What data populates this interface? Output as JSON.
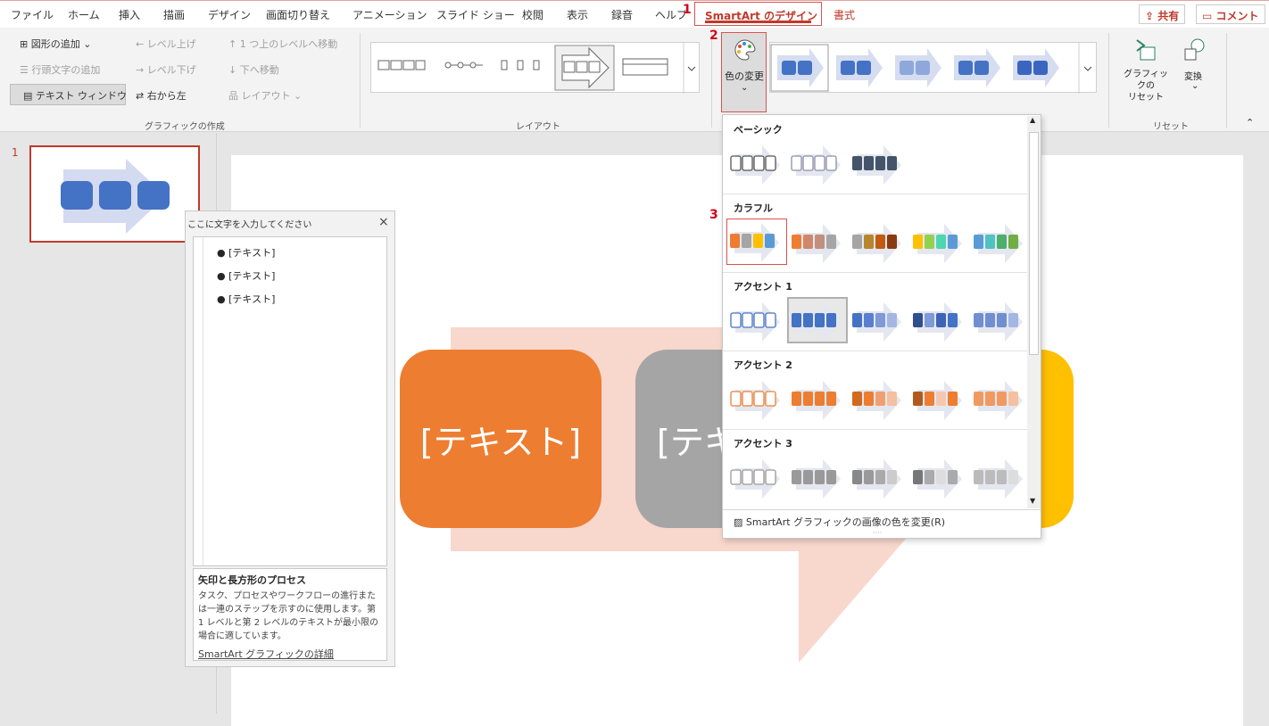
{
  "tabs": [
    "ファイル",
    "ホーム",
    "挿入",
    "描画",
    "デザイン",
    "画面切り替え",
    "アニメーション",
    "スライド ショー",
    "校閲",
    "表示",
    "録音",
    "ヘルプ"
  ],
  "active_tab": "SmartArt のデザイン",
  "format_tab": "書式",
  "share_label": "共有",
  "comment_label": "コメント",
  "steps": [
    "1",
    "2",
    "3"
  ],
  "create_group": {
    "title": "グラフィックの作成",
    "add_shape": "図形の追加",
    "add_bullet": "行頭文字の追加",
    "text_pane": "テキスト ウィンドウ",
    "promote": "レベル上げ",
    "demote": "レベル下げ",
    "rtl": "右から左",
    "move_up": "1 つ上のレベルへ移動",
    "move_down": "下へ移動",
    "layout": "レイアウト"
  },
  "layout_group": {
    "title": "レイアウト"
  },
  "change_colors": "色の変更",
  "reset_group": {
    "title": "リセット",
    "reset": "グラフィックの\nリセット",
    "reset_l1": "グラフィックの",
    "reset_l2": "リセット",
    "convert": "変換"
  },
  "slide_number": "1",
  "text_pane": {
    "title": "ここに文字を入力してください",
    "bullets": [
      "[テキスト]",
      "[テキスト]",
      "[テキスト]"
    ],
    "desc_title": "矢印と長方形のプロセス",
    "desc_body": "タスク、プロセスやワークフローの進行または一連のステップを示すのに使用します。第 1 レベルと第 2 レベルのテキストが最小限の場合に適しています。",
    "link": "SmartArt グラフィックの詳細"
  },
  "slide": {
    "box1": "[テキスト]",
    "box2": "[テキ",
    "box3": "]"
  },
  "dropdown": {
    "sections": [
      "ベーシック",
      "カラフル",
      "アクセント 1",
      "アクセント 2",
      "アクセント 3"
    ],
    "footer": "SmartArt グラフィックの画像の色を変更(R)"
  },
  "colors": {
    "accent": "#c0392b",
    "orange": "#ed7d31",
    "gray": "#a5a5a5",
    "gold": "#ffc000",
    "blue": "#4472c4"
  }
}
